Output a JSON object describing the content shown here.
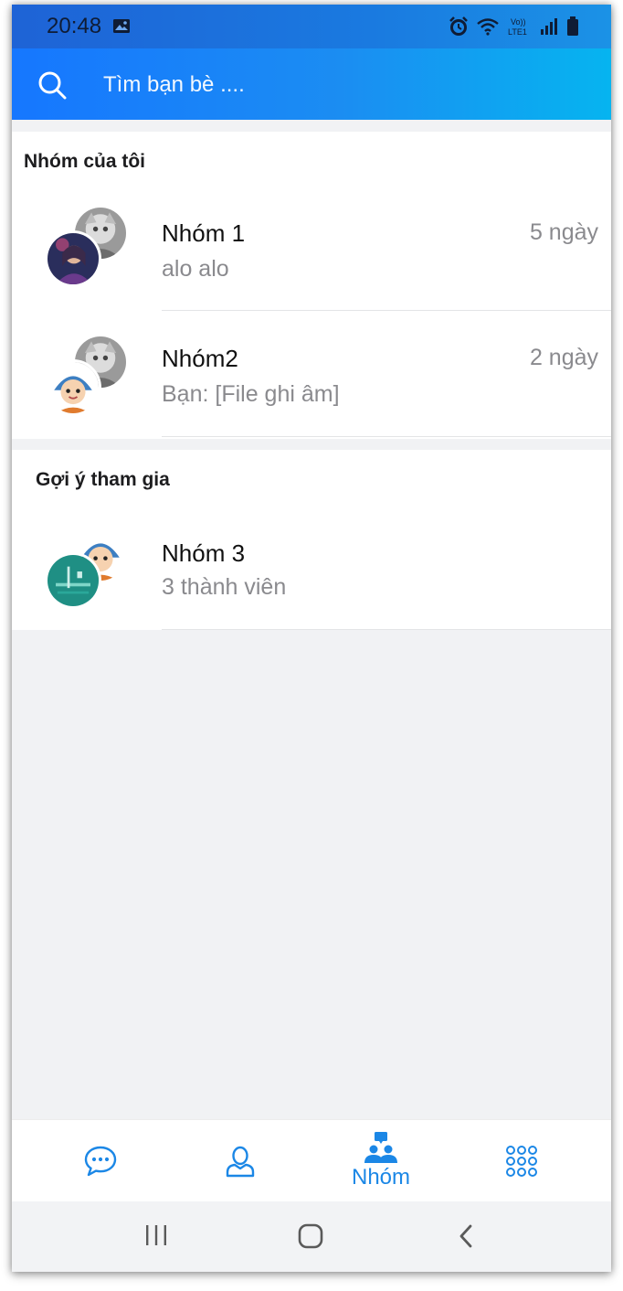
{
  "status_bar": {
    "time": "20:48",
    "icons": [
      "gallery-icon",
      "alarm-icon",
      "wifi-icon",
      "volte-icon",
      "signal-icon",
      "battery-icon"
    ]
  },
  "search": {
    "placeholder": "Tìm bạn bè ....",
    "value": ""
  },
  "my_groups": {
    "title": "Nhóm của tôi",
    "items": [
      {
        "name": "Nhóm 1",
        "subtitle": "alo alo",
        "time": "5 ngày"
      },
      {
        "name": "Nhóm2",
        "subtitle": "Bạn: [File ghi âm]",
        "time": "2 ngày"
      }
    ]
  },
  "suggested": {
    "title": "Gợi ý tham gia",
    "items": [
      {
        "name": "Nhóm 3",
        "subtitle": "3 thành viên"
      }
    ]
  },
  "bottom_nav": {
    "items": [
      {
        "icon": "chat-bubble-icon",
        "label": ""
      },
      {
        "icon": "contacts-icon",
        "label": ""
      },
      {
        "icon": "group-icon",
        "label": "Nhóm",
        "active": true
      },
      {
        "icon": "grid-menu-icon",
        "label": ""
      }
    ]
  },
  "system_nav": {
    "icons": [
      "recent-apps-icon",
      "home-icon",
      "back-icon"
    ]
  },
  "colors": {
    "header_start": "#1677ff",
    "header_end": "#06b4f0",
    "accent": "#1b87e6",
    "background": "#f1f2f4"
  }
}
